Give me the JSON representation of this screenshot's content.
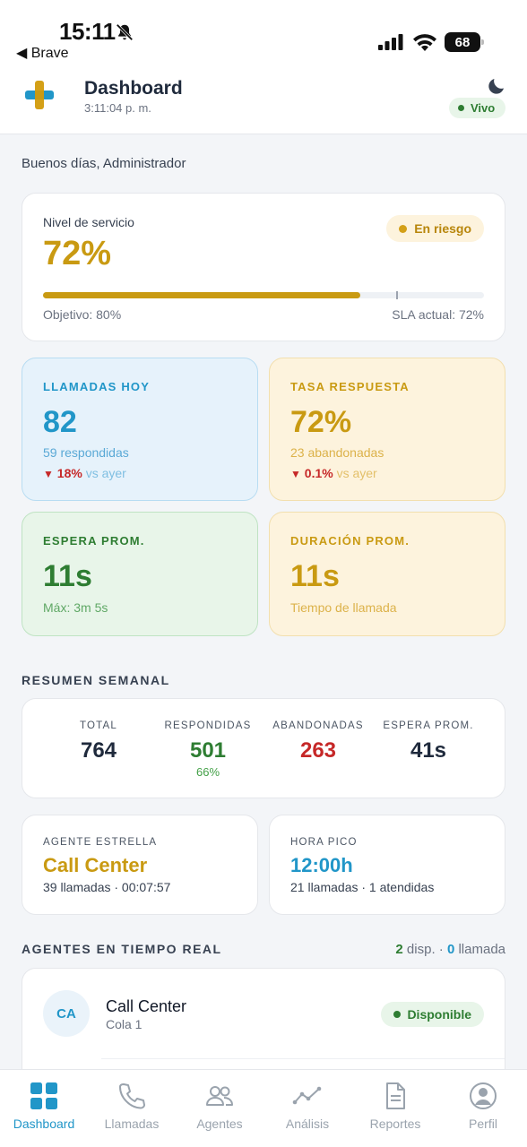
{
  "status_bar": {
    "time": "15:11",
    "back_label": "◀ Brave",
    "battery": "68"
  },
  "header": {
    "title": "Dashboard",
    "time": "3:11:04 p. m.",
    "live_label": "Vivo"
  },
  "greeting": "Buenos días, Administrador",
  "service_level": {
    "label": "Nivel de servicio",
    "value": "72%",
    "status": "En riesgo",
    "progress_fraction": 0.72,
    "target_fraction": 0.8,
    "objective": "Objetivo: 80%",
    "sla": "SLA actual: 72%"
  },
  "metrics": {
    "calls_today": {
      "title": "LLAMADAS HOY",
      "value": "82",
      "sub": "59 respondidas",
      "trend_pct": "18%",
      "trend_text": "vs ayer"
    },
    "response_rate": {
      "title": "TASA RESPUESTA",
      "value": "72%",
      "sub": "23 abandonadas",
      "trend_pct": "0.1%",
      "trend_text": "vs ayer"
    },
    "avg_wait": {
      "title": "ESPERA PROM.",
      "value": "11s",
      "sub": "Máx: 3m 5s"
    },
    "avg_duration": {
      "title": "DURACIÓN PROM.",
      "value": "11s",
      "sub": "Tiempo de llamada"
    }
  },
  "weekly": {
    "title": "RESUMEN SEMANAL",
    "total_label": "TOTAL",
    "total_value": "764",
    "answered_label": "RESPONDIDAS",
    "answered_value": "501",
    "answered_pct": "66%",
    "abandoned_label": "ABANDONADAS",
    "abandoned_value": "263",
    "wait_label": "ESPERA PROM.",
    "wait_value": "41s"
  },
  "star_agent": {
    "label": "AGENTE ESTRELLA",
    "name": "Call Center",
    "details": "39 llamadas · 00:07:57"
  },
  "peak_hour": {
    "label": "HORA PICO",
    "value": "12:00h",
    "details": "21 llamadas · 1 atendidas"
  },
  "agents": {
    "title": "AGENTES EN TIEMPO REAL",
    "available_count": "2",
    "available_label": "disp.",
    "separator": "·",
    "on_call_count": "0",
    "on_call_label": "llamada",
    "list": [
      {
        "initials": "CA",
        "name": "Call Center",
        "queue": "Cola 1",
        "status": "Disponible"
      }
    ]
  },
  "nav": {
    "items": [
      {
        "label": "Dashboard",
        "icon": "grid-icon"
      },
      {
        "label": "Llamadas",
        "icon": "phone-icon"
      },
      {
        "label": "Agentes",
        "icon": "users-icon"
      },
      {
        "label": "Análisis",
        "icon": "chart-line-icon"
      },
      {
        "label": "Reportes",
        "icon": "document-icon"
      },
      {
        "label": "Perfil",
        "icon": "user-circle-icon"
      }
    ],
    "active": "Dashboard"
  },
  "colors": {
    "accent_blue": "#2196c8",
    "accent_gold": "#c99a12",
    "green": "#2e7d32",
    "red": "#c62828"
  }
}
